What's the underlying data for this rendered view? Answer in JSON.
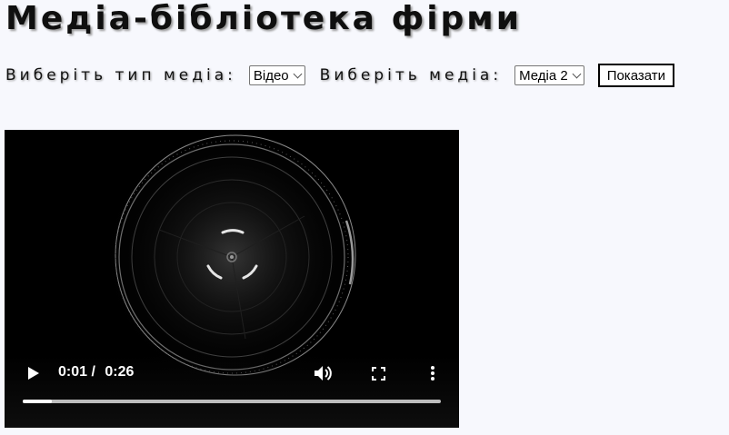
{
  "page": {
    "title": "Медіа-бібліотека фірми"
  },
  "controls": {
    "type_label": "Виберіть тип медіа:",
    "type_selected": "Відео",
    "media_label": "Виберіть медіа:",
    "media_selected": "Медіа 2",
    "show_button": "Показати"
  },
  "player": {
    "current_time": "0:01",
    "separator": "/",
    "duration": "0:26",
    "progress_fraction": 0.07,
    "icons": [
      "play-icon",
      "volume-icon",
      "fullscreen-icon",
      "more-options-icon"
    ]
  }
}
